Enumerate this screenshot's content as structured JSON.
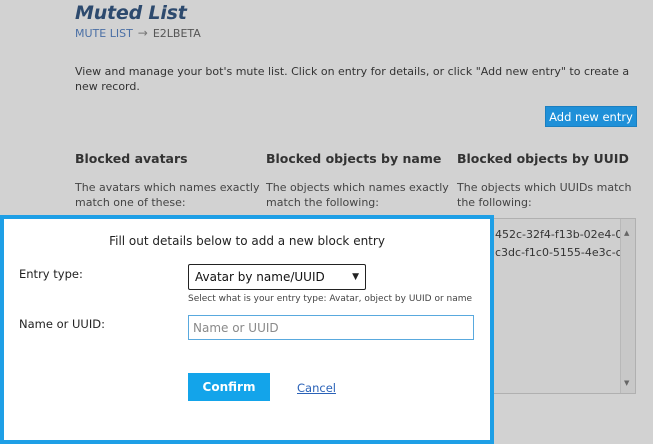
{
  "page": {
    "title": "Muted List",
    "breadcrumb": {
      "parent": "MUTE LIST",
      "arrow": "→",
      "current": "E2LBETA"
    },
    "intro": "View and manage your bot's mute list. Click on entry for details, or click \"Add new entry\" to create a new record.",
    "add_button": "Add new entry"
  },
  "columns": [
    {
      "title": "Blocked avatars",
      "desc": "The avatars which names exactly match one of these:"
    },
    {
      "title": "Blocked objects by name",
      "desc": "The objects which names exactly match the following:"
    },
    {
      "title": "Blocked objects by UUID",
      "desc": "The objects which UUIDs match the following:"
    }
  ],
  "uuid_list": [
    "452c-32f4-f13b-02e4-0",
    "c3dc-f1c0-5155-4e3c-c"
  ],
  "icons": {
    "scroll_up": "▲",
    "scroll_down": "▼",
    "select_arrow": "▼"
  },
  "modal": {
    "title": "Fill out details below to add a new block entry",
    "entry_type_label": "Entry type:",
    "entry_type_value": "Avatar by name/UUID",
    "entry_type_hint": "Select what is your entry type: Avatar, object by UUID or name",
    "name_label": "Name or UUID:",
    "name_placeholder": "Name or UUID",
    "name_value": "",
    "confirm": "Confirm",
    "cancel": "Cancel"
  },
  "colors": {
    "accent": "#1e9fe6",
    "button": "#13a4ea",
    "add_button": "#1f90d8",
    "link": "#2a62b8"
  }
}
